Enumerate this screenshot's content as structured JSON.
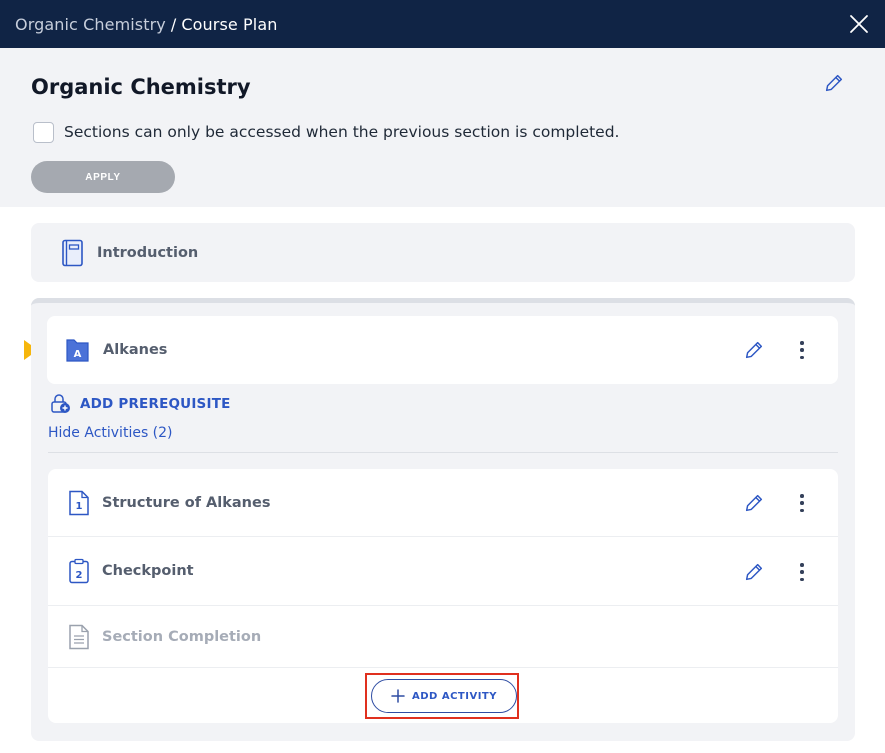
{
  "topbar": {
    "breadcrumb_parent": "Organic Chemistry",
    "separator": "/",
    "breadcrumb_current": "Course Plan"
  },
  "header": {
    "title": "Organic Chemistry",
    "checkbox_label": "Sections can only be accessed when the previous section is completed.",
    "checkbox_checked": false,
    "apply_label": "APPLY"
  },
  "intro": {
    "label": "Introduction"
  },
  "section": {
    "label": "Alkanes",
    "badge": "A",
    "add_prerequisite_label": "ADD PREREQUISITE",
    "hide_activities_label": "Hide Activities (2)"
  },
  "activities": [
    {
      "label": "Structure of Alkanes",
      "number": "1"
    },
    {
      "label": "Checkpoint",
      "number": "2"
    },
    {
      "label": "Section Completion"
    }
  ],
  "add_activity": {
    "label": "ADD ACTIVITY"
  },
  "colors": {
    "topbar": "#102445",
    "accent": "#2d57c4",
    "marker": "#f6b60c",
    "highlight": "#e0301e"
  }
}
